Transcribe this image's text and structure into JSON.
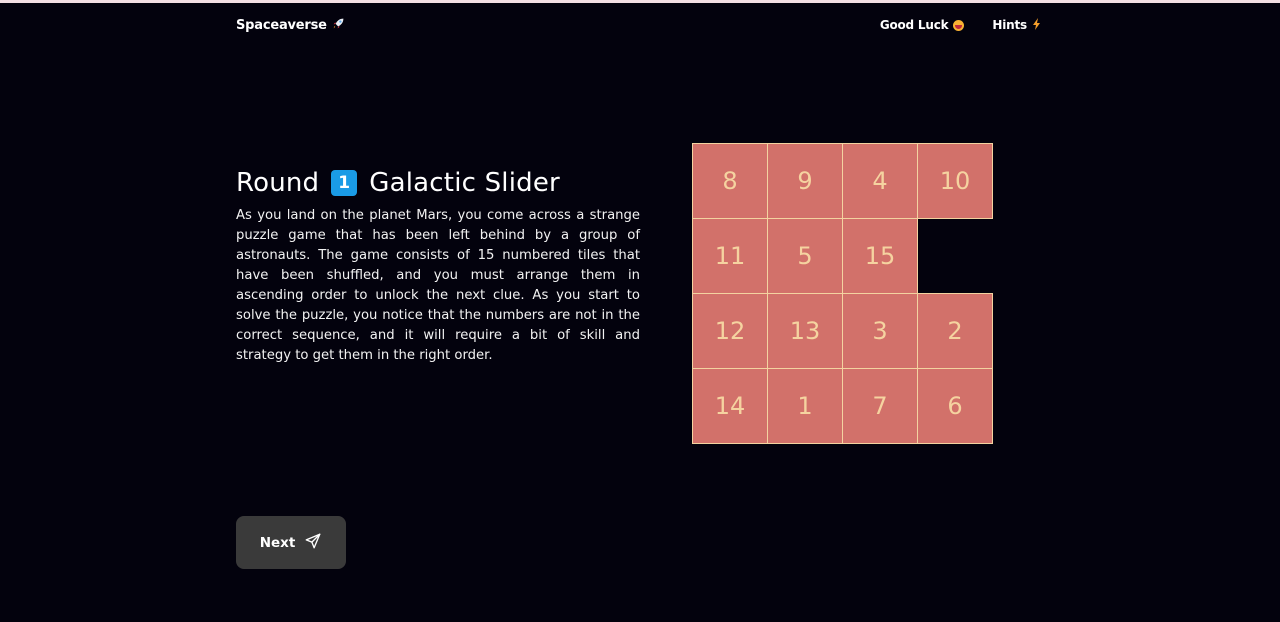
{
  "nav": {
    "brand": "Spaceaverse",
    "brand_icon": "rocket-icon",
    "links": [
      {
        "label": "Good Luck",
        "icon": "grinning-face-icon"
      },
      {
        "label": "Hints",
        "icon": "lightning-icon"
      }
    ]
  },
  "round": {
    "prefix": "Round",
    "number": "1",
    "title": "Galactic Slider"
  },
  "description": "As you land on the planet Mars, you come across a strange puzzle game that has been left behind by a group of astronauts. The game consists of 15 numbered tiles that have been shuffled, and you must arrange them in ascending order to unlock the next clue. As you start to solve the puzzle, you notice that the numbers are not in the correct sequence, and it will require a bit of skill and strategy to get them in the right order.",
  "puzzle": {
    "grid": [
      [
        8,
        9,
        4,
        10
      ],
      [
        11,
        5,
        15,
        null
      ],
      [
        12,
        13,
        3,
        2
      ],
      [
        14,
        1,
        7,
        6
      ]
    ],
    "colors": {
      "tile": "#d2716a",
      "tile_text": "#f5d3a0",
      "tile_border": "#f3d3a0"
    }
  },
  "next_button": {
    "label": "Next",
    "icon": "send-icon"
  }
}
